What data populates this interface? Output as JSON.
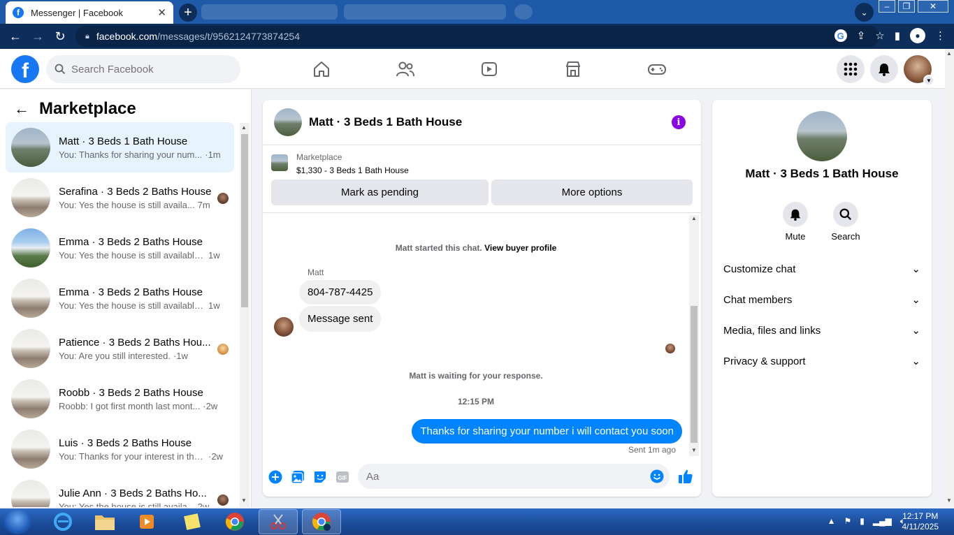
{
  "browser": {
    "tab_title": "Messenger | Facebook",
    "url_host": "facebook.com",
    "url_path": "/messages/t/9562124773874254"
  },
  "fb": {
    "search_placeholder": "Search Facebook"
  },
  "sidebar": {
    "title": "Marketplace",
    "conversations": [
      {
        "name": "Matt · 3 Beds 1 Bath House",
        "preview": "You: Thanks for sharing your num...",
        "time": "·1m",
        "thumb": "house-exterior"
      },
      {
        "name": "Serafina · 3 Beds 2 Baths House",
        "preview": "You: Yes the house is still availa...",
        "time": "7m",
        "thumb": "house-interior"
      },
      {
        "name": "Emma · 3 Beds 2 Baths House",
        "preview": "You: Yes the house is still available ...",
        "time": "1w",
        "thumb": "house-blue"
      },
      {
        "name": "Emma · 3 Beds 2 Baths House",
        "preview": "You: Yes the house is still available ...",
        "time": "1w",
        "thumb": "house-interior"
      },
      {
        "name": "Patience · 3 Beds 2 Baths Hou...",
        "preview": "You: Are you still interested.",
        "time": "·1w",
        "thumb": "house-interior"
      },
      {
        "name": "Roobb · 3 Beds 2 Baths House",
        "preview": "Roobb: I got first month last mont...",
        "time": "·2w",
        "thumb": "house-interior"
      },
      {
        "name": "Luis · 3 Beds 2 Baths House",
        "preview": "You: Thanks for your interest in the...",
        "time": "·2w",
        "thumb": "house-interior"
      },
      {
        "name": "Julie Ann · 3 Beds 2 Baths Ho...",
        "preview": "You: Yes the house is still availa...",
        "time": "2w",
        "thumb": "house-interior"
      }
    ]
  },
  "chat": {
    "title": "Matt · 3 Beds 1 Bath House",
    "listing_source": "Marketplace",
    "listing_price": "$1,330 - 3 Beds 1 Bath House",
    "mark_pending": "Mark as pending",
    "more_options": "More options",
    "started_text": "Matt started this chat.",
    "view_profile": "View buyer profile",
    "sender": "Matt",
    "msg1": "804-787-4425",
    "msg2": "Message sent",
    "waiting": "Matt is waiting for your response.",
    "timestamp": "12:15 PM",
    "outgoing": "Thanks for sharing your number i will contact you soon",
    "sent_label": "Sent 1m ago",
    "composer_placeholder": "Aa"
  },
  "info": {
    "name": "Matt · 3 Beds 1 Bath House",
    "mute": "Mute",
    "search": "Search",
    "rows": [
      "Customize chat",
      "Chat members",
      "Media, files and links",
      "Privacy & support"
    ]
  },
  "taskbar": {
    "time": "12:17 PM",
    "date": "4/11/2025"
  },
  "colors": {
    "fb_blue": "#1877f2",
    "outgoing_bubble": "#0084ff",
    "info_purple": "#8a05e6"
  }
}
